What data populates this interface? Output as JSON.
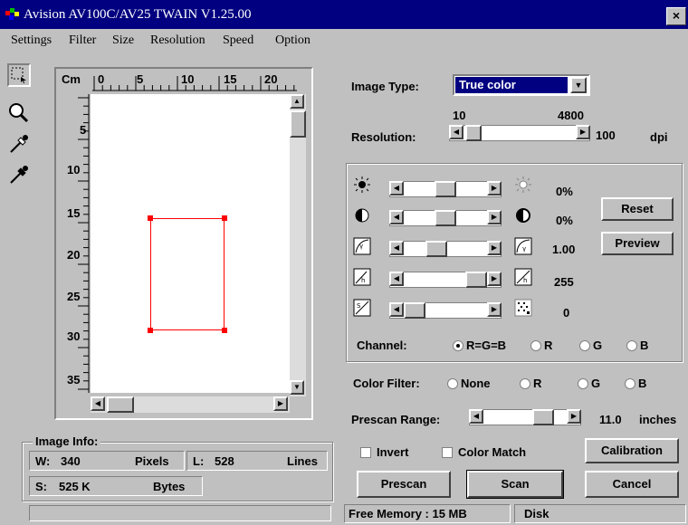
{
  "window": {
    "title": "Avision AV100C/AV25 TWAIN V1.25.00",
    "close": "×"
  },
  "menu": [
    "Settings",
    "Filter",
    "Size",
    "Resolution",
    "Speed",
    "Option"
  ],
  "tools": [
    "select-tool",
    "zoom-tool",
    "white-dropper",
    "black-dropper"
  ],
  "ruler": {
    "unit": "Cm",
    "top_ticks": [
      "0",
      "5",
      "10",
      "15",
      "20"
    ],
    "left_ticks": [
      "5",
      "10",
      "15",
      "20",
      "25",
      "30",
      "35"
    ]
  },
  "image_type": {
    "label": "Image Type:",
    "value": "True color"
  },
  "resolution": {
    "label": "Resolution:",
    "min": "10",
    "max": "4800",
    "value": "100",
    "unit": "dpi",
    "level": 0.02
  },
  "adjust": {
    "brightness": {
      "value": "0%",
      "level": 0.5
    },
    "contrast": {
      "value": "0%",
      "level": 0.5
    },
    "gamma": {
      "value": "1.00",
      "level": 0.35
    },
    "highlight": {
      "value": "255",
      "level": 1.0
    },
    "shadow": {
      "value": "0",
      "level": 0.0
    }
  },
  "buttons": {
    "reset": "Reset",
    "preview": "Preview",
    "calibration": "Calibration",
    "prescan": "Prescan",
    "scan": "Scan",
    "cancel": "Cancel"
  },
  "channel": {
    "label": "Channel:",
    "options": [
      "R=G=B",
      "R",
      "G",
      "B"
    ],
    "selected": "R=G=B"
  },
  "color_filter": {
    "label": "Color Filter:",
    "options": [
      "None",
      "R",
      "G",
      "B"
    ]
  },
  "prescan_range": {
    "label": "Prescan Range:",
    "value": "11.0",
    "unit": "inches",
    "level": 0.8
  },
  "invert": {
    "label": "Invert",
    "checked": false
  },
  "color_match": {
    "label": "Color Match",
    "checked": false
  },
  "image_info": {
    "title": "Image Info:",
    "w_label": "W:",
    "w_value": "340",
    "w_unit": "Pixels",
    "l_label": "L:",
    "l_value": "528",
    "l_unit": "Lines",
    "s_label": "S:",
    "s_value": "525 K",
    "s_unit": "Bytes"
  },
  "status": {
    "memory": "Free Memory : 15 MB",
    "disk": "Disk"
  },
  "colors": {
    "titlebar": "#000080",
    "face": "#c0c0c0",
    "selection": "#ff0000",
    "highlight": "#000080"
  }
}
